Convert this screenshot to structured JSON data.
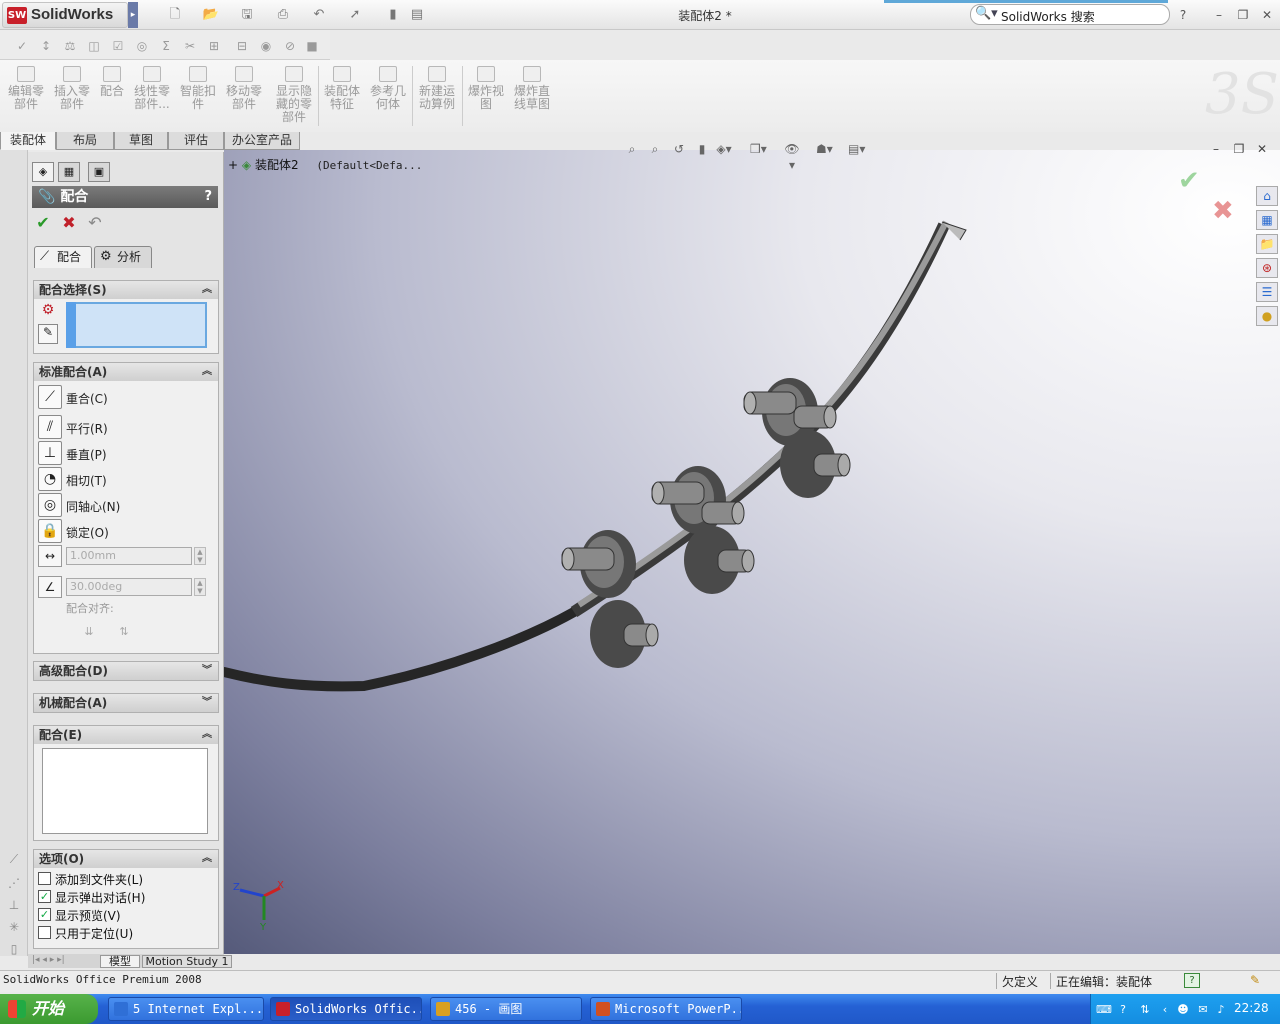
{
  "app": {
    "brand": "SolidWorks",
    "doc_title": "装配体2 *",
    "search_placeholder": "SolidWorks 搜索",
    "help": "?"
  },
  "command_manager": {
    "buttons": [
      {
        "label": "编辑零\n部件",
        "icon": "edit-component-icon"
      },
      {
        "label": "插入零\n部件",
        "icon": "insert-component-icon"
      },
      {
        "label": "配合",
        "icon": "mate-icon"
      },
      {
        "label": "线性零\n部件...",
        "icon": "linear-pattern-icon"
      },
      {
        "label": "智能扣\n件",
        "icon": "smart-fastener-icon"
      },
      {
        "label": "移动零\n部件",
        "icon": "move-component-icon"
      },
      {
        "label": "显示隐\n藏的零\n部件",
        "icon": "show-hidden-icon"
      },
      {
        "label": "装配体\n特征",
        "icon": "assembly-feature-icon"
      },
      {
        "label": "参考几\n何体",
        "icon": "reference-geometry-icon"
      },
      {
        "label": "新建运\n动算例",
        "icon": "motion-study-icon"
      },
      {
        "label": "爆炸视\n图",
        "icon": "exploded-view-icon"
      },
      {
        "label": "爆炸直\n线草图",
        "icon": "explode-line-sketch-icon"
      }
    ],
    "tabs": [
      "装配体",
      "布局",
      "草图",
      "评估",
      "办公室产品"
    ]
  },
  "property_manager": {
    "title": "配合",
    "tabs": [
      "配合",
      "分析"
    ],
    "sections": {
      "selections": "配合选择(S)",
      "standard": "标准配合(A)",
      "advanced": "高级配合(D)",
      "mechanical": "机械配合(A)",
      "mates": "配合(E)",
      "options": "选项(O)"
    },
    "standard_mates": [
      "重合(C)",
      "平行(R)",
      "垂直(P)",
      "相切(T)",
      "同轴心(N)",
      "锁定(O)"
    ],
    "distance_value": "1.00mm",
    "angle_value": "30.00deg",
    "alignment_label": "配合对齐:",
    "options": [
      {
        "label": "添加到文件夹(L)",
        "checked": false
      },
      {
        "label": "显示弹出对话(H)",
        "checked": true
      },
      {
        "label": "显示预览(V)",
        "checked": true
      },
      {
        "label": "只用于定位(U)",
        "checked": false
      }
    ]
  },
  "bottom_tabs": [
    "模型",
    "Motion Study 1"
  ],
  "tree": {
    "root": "装配体2",
    "config": "(Default<Defa..."
  },
  "axes": {
    "z": "Z",
    "x": "X",
    "y": "Y"
  },
  "status": {
    "product": "SolidWorks Office Premium 2008",
    "definition": "欠定义",
    "editing": "正在编辑：装配体",
    "help": "?"
  },
  "taskbar": {
    "start": "开始",
    "tasks": [
      {
        "label": "5 Internet Expl...",
        "color": "#2f6fd6"
      },
      {
        "label": "SolidWorks Offic...",
        "color": "#c8202a"
      },
      {
        "label": "456 - 画图",
        "color": "#d8a020"
      },
      {
        "label": "Microsoft PowerP...",
        "color": "#d05020"
      }
    ],
    "clock": "22:28"
  },
  "colors": {
    "accent": "#2561d4",
    "ok": "#2a9a2a",
    "cancel": "#c0202a",
    "rail": "#3a3a3a",
    "roller": "#6a6a6a"
  }
}
